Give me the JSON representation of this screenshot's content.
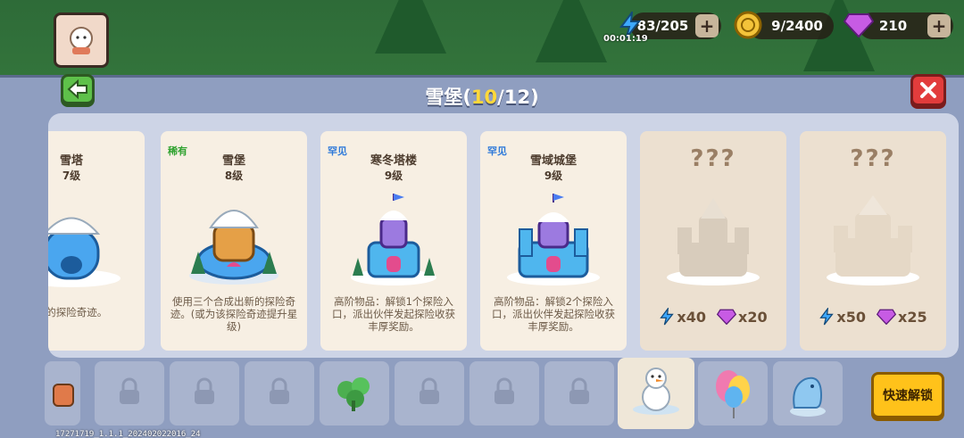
{
  "hud": {
    "timer": "00:01:19",
    "energy": {
      "value": "83/205",
      "icon": "lightning-icon",
      "color": "#3ea9ff"
    },
    "coins": {
      "value": "9/2400",
      "icon": "coin-icon",
      "color": "#f3c33a"
    },
    "gems": {
      "value": "210",
      "icon": "gem-icon",
      "color": "#c75be4"
    },
    "plus_label": "+"
  },
  "panel": {
    "title_prefix": "雪堡(",
    "title_count": "10",
    "title_suffix": "/12)",
    "back_icon": "back-arrow-icon",
    "close_icon": "close-icon"
  },
  "cards": [
    {
      "name": "雪塔",
      "level": "7级",
      "badge": "",
      "desc": "新的探险奇迹。",
      "locked": false
    },
    {
      "name": "雪堡",
      "level": "8级",
      "badge": "稀有",
      "badge_type": "rare",
      "desc": "使用三个合成出新的探险奇迹。(或为该探险奇迹提升星级)",
      "locked": false
    },
    {
      "name": "寒冬塔楼",
      "level": "9级",
      "badge": "罕见",
      "badge_type": "common",
      "desc": "高阶物品：解锁1个探险入口，派出伙伴发起探险收获丰厚奖励。",
      "locked": false
    },
    {
      "name": "雪域城堡",
      "level": "9级",
      "badge": "罕见",
      "badge_type": "common",
      "desc": "高阶物品：解锁2个探险入口，派出伙伴发起探险收获丰厚奖励。",
      "locked": false
    },
    {
      "name": "???",
      "locked": true,
      "cost_energy": "x40",
      "cost_gems": "x20"
    },
    {
      "name": "???",
      "locked": true,
      "cost_energy": "x50",
      "cost_gems": "x25"
    }
  ],
  "slots": [
    {
      "state": "partial"
    },
    {
      "state": "locked"
    },
    {
      "state": "locked"
    },
    {
      "state": "locked"
    },
    {
      "state": "clover"
    },
    {
      "state": "locked"
    },
    {
      "state": "locked"
    },
    {
      "state": "locked"
    },
    {
      "state": "snowman",
      "active": true
    },
    {
      "state": "balloon"
    },
    {
      "state": "ice-statue"
    }
  ],
  "quick_unlock_label": "快速解锁",
  "version": "17271719_1.1.1_202402022016_24"
}
